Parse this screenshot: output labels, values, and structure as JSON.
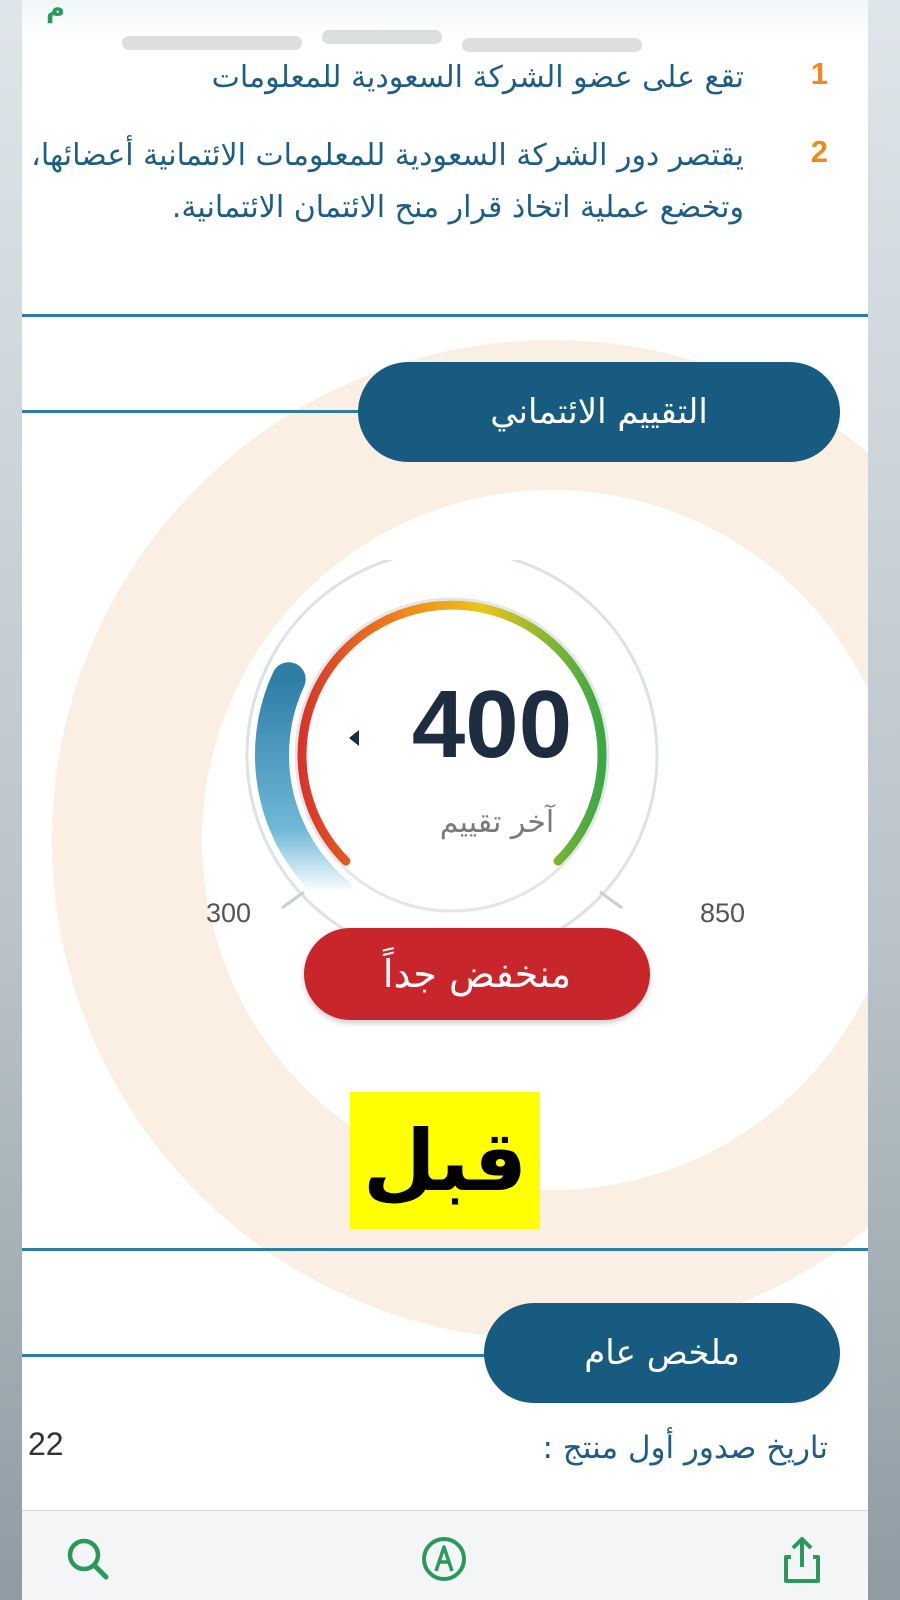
{
  "notes": [
    {
      "number": "1",
      "text": "تقع على عضو الشركة السعودية للمعلومات"
    },
    {
      "number": "2",
      "text": "يقتصر دور الشركة السعودية للمعلومات الائتمانية أعضائها، وتخضع عملية اتخاذ قرار منح الائتمان الائتمانية."
    }
  ],
  "credit_section": {
    "title": "التقييم الائتماني",
    "score": "400",
    "caption": "آخر تقييم",
    "min_label": "300",
    "max_label": "850",
    "rating": "منخفض جداً",
    "min": 300,
    "max": 850,
    "value": 400
  },
  "overlay": {
    "label": "قبل"
  },
  "summary_section": {
    "title": "ملخص عام",
    "first_product_label": "تاريخ صدور أول منتج :",
    "first_product_value": "22"
  },
  "toolbar": {
    "search_icon": "search-icon",
    "compass_icon": "compass-icon",
    "share_icon": "share-icon"
  },
  "colors": {
    "primary": "#175b80",
    "accent_orange": "#f08a1c",
    "rating_red": "#c8262a",
    "highlight_yellow": "#ffff00"
  }
}
